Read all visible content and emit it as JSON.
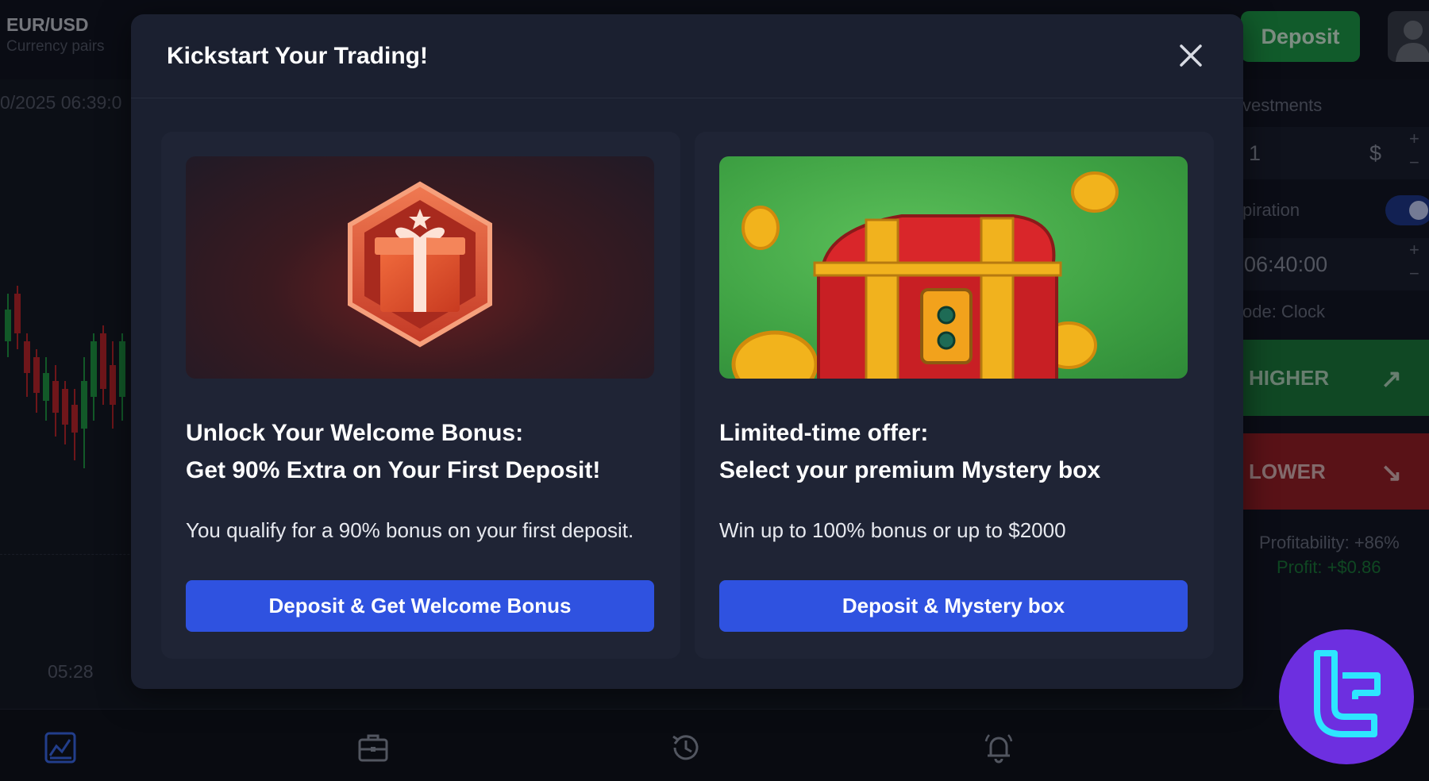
{
  "header": {
    "pair": "EUR/USD",
    "pair_subtitle": "Currency pairs",
    "deposit_label": "Deposit"
  },
  "chart": {
    "date_time": "0/2025 06:39:0",
    "time_label": "05:28"
  },
  "side_panel": {
    "investments_label": "vestments",
    "amount_value": "1",
    "currency_symbol": "$",
    "expiration_label": "piration",
    "expiration_time": "06:40:00",
    "mode_label": "ode: Clock",
    "higher_label": "HIGHER",
    "lower_label": "LOWER",
    "profitability": "Profitability: +86%",
    "profit": "Profit: +$0.86"
  },
  "modal": {
    "title": "Kickstart Your Trading!",
    "cards": [
      {
        "heading_line1": "Unlock Your Welcome Bonus:",
        "heading_line2": "Get 90% Extra on Your First Deposit!",
        "text": "You qualify for a 90% bonus on your first deposit.",
        "button": "Deposit & Get Welcome Bonus"
      },
      {
        "heading_line1": "Limited-time offer:",
        "heading_line2": "Select your premium Mystery box",
        "text": "Win up to 100% bonus or up to $2000",
        "button": "Deposit & Mystery box"
      }
    ]
  },
  "bottom_nav": {
    "icons": [
      "chart-icon",
      "briefcase-icon",
      "history-icon",
      "notification-bell-icon"
    ]
  },
  "colors": {
    "background": "#161a26",
    "modal": "#1b2030",
    "card": "#1f2435",
    "primary_button": "#2f52e0",
    "deposit_green": "#1e9e4a",
    "higher_green": "#1d7d3e",
    "lower_red": "#9a1f28",
    "brand_purple": "#6d2fe0",
    "brand_cyan": "#2ee6ff"
  }
}
